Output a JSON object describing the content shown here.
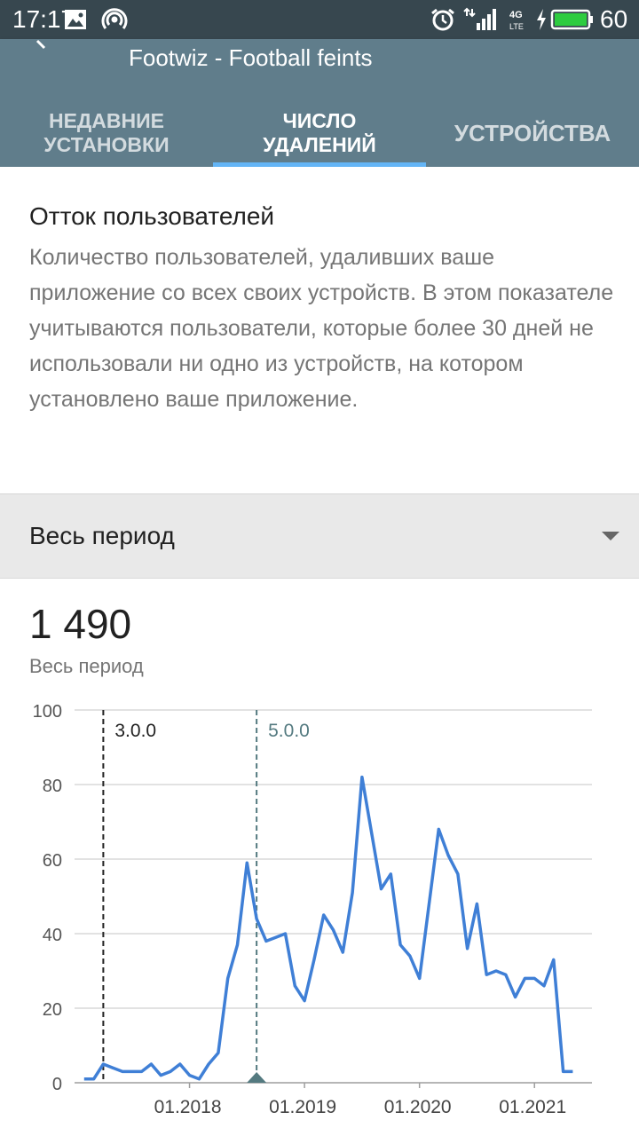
{
  "status_bar": {
    "time": "17:17",
    "battery_level": "60",
    "icons": [
      "image-icon",
      "hotspot-icon",
      "alarm-icon",
      "signal-icon",
      "4g-lte-icon",
      "charging-icon",
      "battery-icon"
    ]
  },
  "app_header": {
    "title": "Footwiz - Football feints",
    "tabs": [
      {
        "label": "НЕДАВНИЕ\nУСТАНОВКИ",
        "active": false
      },
      {
        "label": "ЧИСЛО\nУДАЛЕНИЙ",
        "active": true
      },
      {
        "label": "УСТРОЙСТВА",
        "active": false
      }
    ]
  },
  "info": {
    "title": "Отток пользователей",
    "description": "Количество пользователей, удаливших ваше приложение со всех своих устройств. В этом показателе учитываются пользователи, которые более 30 дней не использовали ни одно из устройств, на котором установлено ваше приложение."
  },
  "period_selector": {
    "label": "Весь период"
  },
  "metric": {
    "value": "1 490",
    "caption": "Весь период"
  },
  "colors": {
    "status_bar": "#37474f",
    "header": "#607d8b",
    "tab_indicator": "#64b5f6",
    "line": "#3f7fd6",
    "marker_teal": "#547a80"
  },
  "chart_data": {
    "type": "line",
    "title": "",
    "xlabel": "",
    "ylabel": "",
    "ylim": [
      0,
      100
    ],
    "y_ticks": [
      0,
      20,
      40,
      60,
      80,
      100
    ],
    "x_tick_labels": [
      "01.2018",
      "01.2019",
      "01.2020",
      "01.2021"
    ],
    "grid": true,
    "markers": [
      {
        "label": "3.0.0",
        "date": "2017-04"
      },
      {
        "label": "5.0.0",
        "date": "2018-08"
      }
    ],
    "series": [
      {
        "x": [
          "2017-02",
          "2017-03",
          "2017-04",
          "2017-05",
          "2017-06",
          "2017-07",
          "2017-08",
          "2017-09",
          "2017-10",
          "2017-11",
          "2017-12",
          "2018-01",
          "2018-02",
          "2018-03",
          "2018-04",
          "2018-05",
          "2018-06",
          "2018-07",
          "2018-08",
          "2018-09",
          "2018-10",
          "2018-11",
          "2018-12",
          "2019-01",
          "2019-02",
          "2019-03",
          "2019-04",
          "2019-05",
          "2019-06",
          "2019-07",
          "2019-08",
          "2019-09",
          "2019-10",
          "2019-11",
          "2019-12",
          "2020-01",
          "2020-02",
          "2020-03",
          "2020-04",
          "2020-05",
          "2020-06",
          "2020-07",
          "2020-08",
          "2020-09",
          "2020-10",
          "2020-11",
          "2020-12",
          "2021-01",
          "2021-02",
          "2021-03",
          "2021-04",
          "2021-05"
        ],
        "values": [
          1,
          1,
          5,
          4,
          3,
          3,
          3,
          5,
          2,
          3,
          5,
          2,
          1,
          5,
          8,
          28,
          37,
          59,
          44,
          38,
          39,
          40,
          26,
          22,
          33,
          45,
          41,
          35,
          51,
          82,
          67,
          52,
          56,
          37,
          34,
          28,
          48,
          68,
          61,
          56,
          36,
          48,
          29,
          30,
          29,
          23,
          28,
          28,
          26,
          33,
          3,
          3
        ]
      }
    ]
  }
}
